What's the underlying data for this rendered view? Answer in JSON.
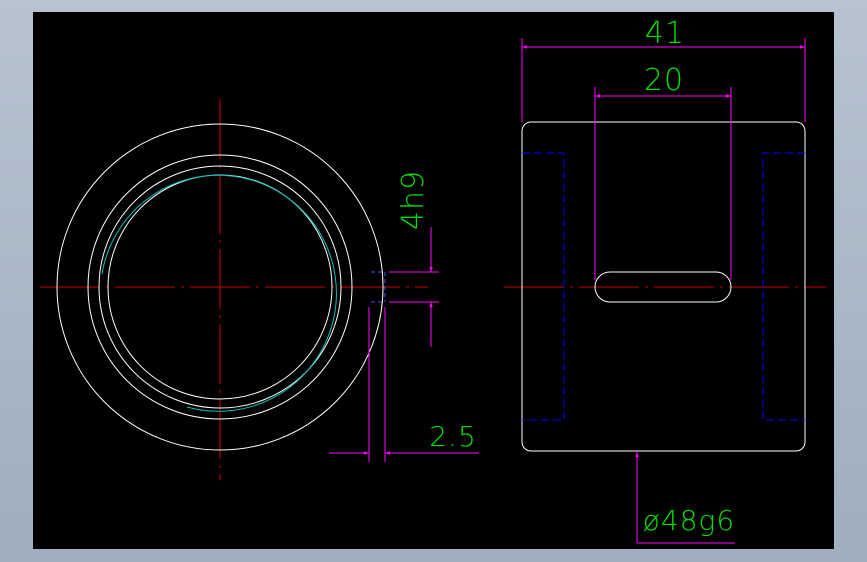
{
  "colors": {
    "background": "#000000",
    "frame": "#aab6c4",
    "outline": "#ffffff",
    "centerline": "#cc0000",
    "dimension": "#ff00ff",
    "dimension_text": "#00e000",
    "hidden_line": "#0000ff",
    "thread_arc": "#00c0c0"
  },
  "dimensions": {
    "overall_length": "41",
    "slot_length": "20",
    "key_width": "4h9",
    "key_depth": "2.5",
    "outer_diameter": "ø48g6"
  }
}
